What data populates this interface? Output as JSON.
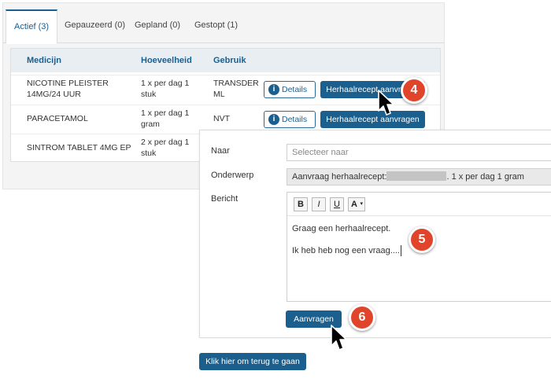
{
  "tabs": [
    {
      "label": "Actief (3)",
      "active": true
    },
    {
      "label": "Gepauzeerd (0)",
      "active": false
    },
    {
      "label": "Gepland (0)",
      "active": false
    },
    {
      "label": "Gestopt (1)",
      "active": false
    }
  ],
  "table": {
    "headers": [
      "Medicijn",
      "Hoeveelheid",
      "Gebruik"
    ],
    "rows": [
      {
        "medicijn": "NICOTINE PLEISTER 14MG/24 UUR",
        "hoeveelheid": "1 x per dag 1 stuk",
        "gebruik": "TRANSDERML"
      },
      {
        "medicijn": "PARACETAMOL",
        "hoeveelheid": "1 x per dag 1 gram",
        "gebruik": "NVT"
      },
      {
        "medicijn": "SINTROM TABLET 4MG EP",
        "hoeveelheid": "2 x per dag 1 stuk",
        "gebruik": ""
      }
    ],
    "details_label": "Details",
    "refill_label": "Herhaalrecept aanvragen"
  },
  "form": {
    "to_label": "Naar",
    "to_placeholder": "Selecteer naar",
    "subject_label": "Onderwerp",
    "subject_prefix": "Aanvraag herhaalrecept:",
    "subject_suffix": ". 1 x per dag 1 gram",
    "message_label": "Bericht",
    "toolbar": {
      "bold": "B",
      "italic": "I",
      "underline": "U",
      "font_color": "A"
    },
    "message_lines": [
      "Graag een herhaalrecept.",
      "Ik heb heb nog een vraag...."
    ],
    "submit_label": "Aanvragen"
  },
  "back_label": "Klik hier om terug te gaan",
  "steps": [
    "4",
    "5",
    "6"
  ],
  "colors": {
    "accent": "#1a5f8e",
    "step_badge": "#e0452b"
  }
}
